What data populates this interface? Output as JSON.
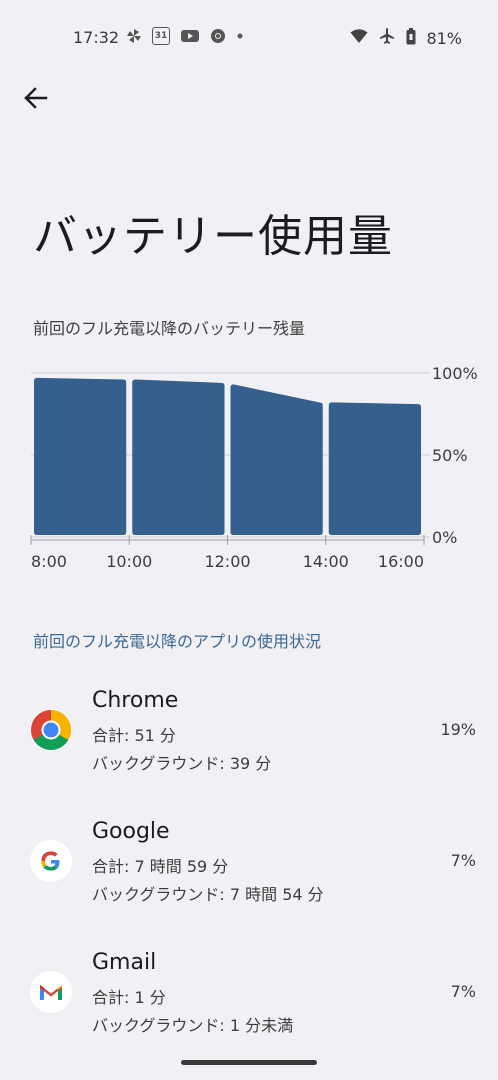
{
  "status_bar": {
    "time": "17:32",
    "calendar_day": "31",
    "battery_percent": "81%",
    "icons_left": [
      "pinwheel-icon",
      "calendar-icon",
      "youtube-icon",
      "chrome-icon",
      "dot-icon"
    ],
    "icons_right": [
      "wifi-icon",
      "airplane-icon",
      "battery-icon"
    ]
  },
  "header": {
    "back_icon": "arrow-left-icon",
    "title": "バッテリー使用量"
  },
  "chart_section": {
    "heading": "前回のフル充電以降のバッテリー残量"
  },
  "chart_data": {
    "type": "area",
    "x_ticks": [
      "8:00",
      "10:00",
      "12:00",
      "14:00",
      "16:00"
    ],
    "y_ticks": [
      "100%",
      "50%",
      "0%"
    ],
    "ylim": [
      0,
      100
    ],
    "segments": [
      {
        "start": "8:00",
        "end": "10:00",
        "values": [
          97,
          96
        ]
      },
      {
        "start": "10:00",
        "end": "12:00",
        "values": [
          96,
          94
        ]
      },
      {
        "start": "12:00",
        "end": "14:00",
        "values": [
          93,
          82
        ]
      },
      {
        "start": "14:00",
        "end": "16:00",
        "values": [
          82,
          81
        ]
      }
    ],
    "color": "#355f8c",
    "grid": true
  },
  "apps_section": {
    "heading": "前回のフル充電以降のアプリの使用状況",
    "apps": [
      {
        "name": "Chrome",
        "icon": "chrome-icon",
        "total": "合計: 51 分",
        "background": "バックグラウンド: 39 分",
        "percent": "19%"
      },
      {
        "name": "Google",
        "icon": "google-icon",
        "total": "合計: 7 時間 59 分",
        "background": "バックグラウンド: 7 時間 54 分",
        "percent": "7%"
      },
      {
        "name": "Gmail",
        "icon": "gmail-icon",
        "total": "合計: 1 分",
        "background": "バックグラウンド: 1 分未満",
        "percent": "7%"
      }
    ]
  },
  "colors": {
    "background": "#f1f0f4",
    "accent": "#3b6894",
    "bar": "#355f8c"
  }
}
